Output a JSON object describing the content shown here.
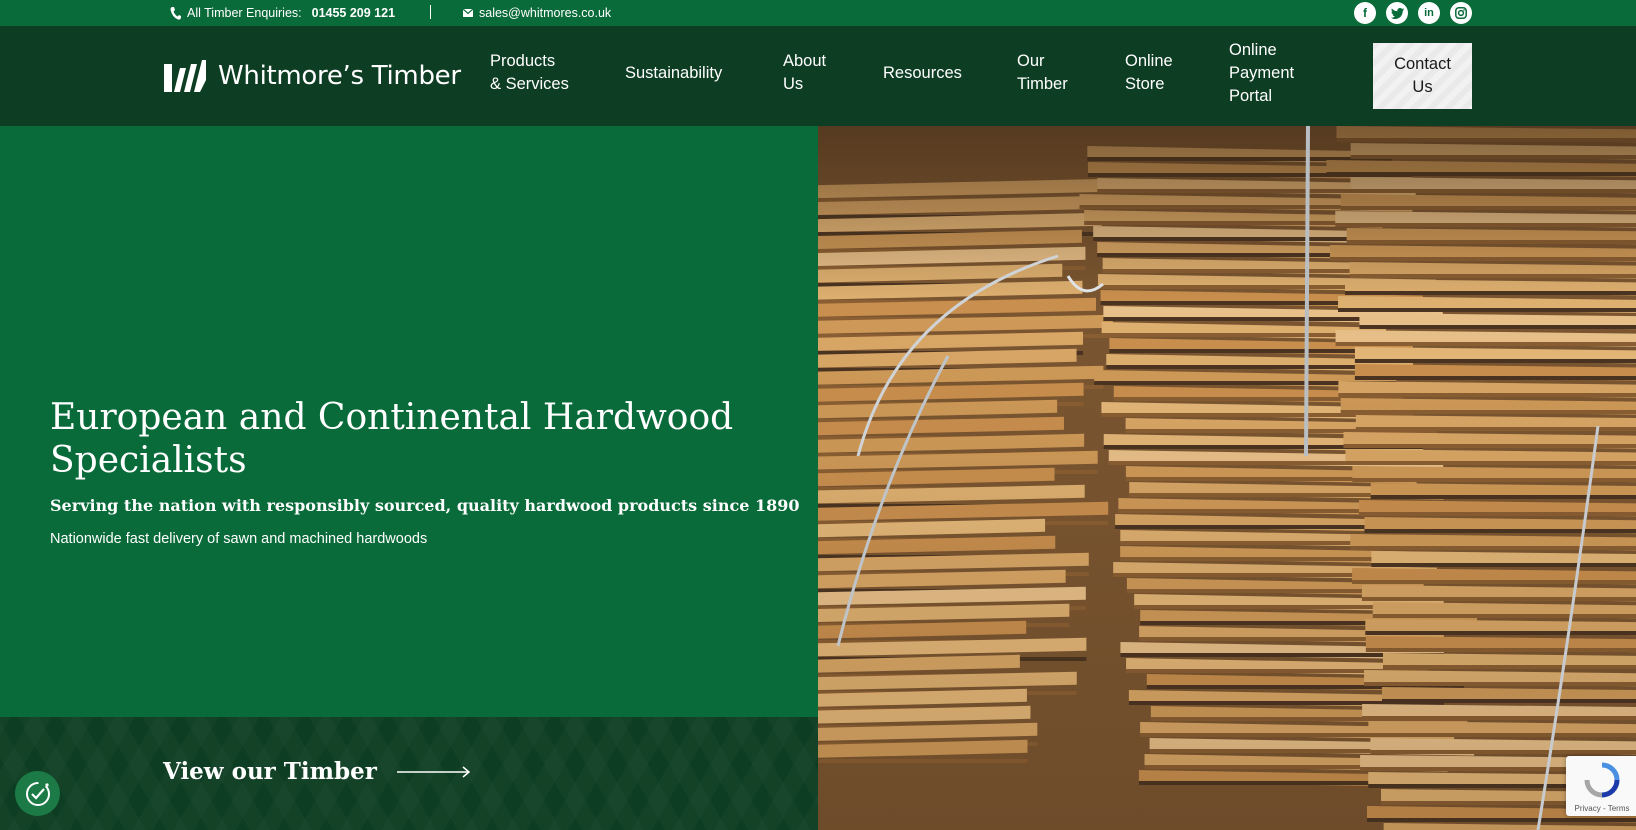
{
  "topbar": {
    "phone_label": "All Timber Enquiries:",
    "phone_number": "01455 209 121",
    "email": "sales@whitmores.co.uk",
    "social": [
      "facebook-icon",
      "twitter-icon",
      "linkedin-icon",
      "instagram-icon"
    ]
  },
  "brand": {
    "name": "Whitmore’s Timber"
  },
  "nav": {
    "products_line1": "Products",
    "products_line2": "& Services",
    "sustainability": "Sustainability",
    "about_line1": "About",
    "about_line2": "Us",
    "resources": "Resources",
    "timber_line1": "Our",
    "timber_line2": "Timber",
    "store_line1": "Online",
    "store_line2": "Store",
    "payment_line1": "Online",
    "payment_line2": "Payment",
    "payment_line3": "Portal",
    "contact_line1": "Contact",
    "contact_line2": "Us"
  },
  "hero": {
    "title": "European and Continental Hardwood Specialists",
    "subtitle": "Serving the nation with responsibly sourced, quality hardwood products since 1890",
    "tagline": "Nationwide fast delivery of sawn and machined hardwoods"
  },
  "cta": {
    "label": "View our Timber"
  },
  "recaptcha": {
    "text": "Privacy - Terms"
  },
  "colors": {
    "green": "#0a6b3a",
    "dark_green": "#0d3d22",
    "white": "#ffffff"
  }
}
